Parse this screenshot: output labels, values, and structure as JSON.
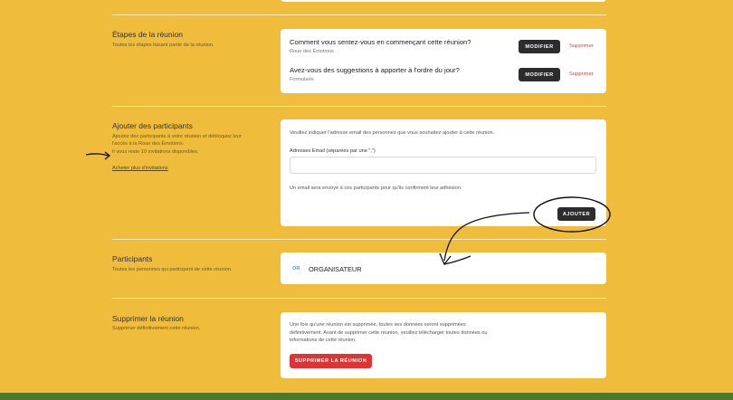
{
  "steps": {
    "title": "Étapes de la réunion",
    "description": "Toutes les étapes faisant partie de la réunion.",
    "items": [
      {
        "question": "Comment vous sentez-vous en commençant cette réunion?",
        "type": "Roue des Émotions",
        "edit_label": "MODIFIER",
        "delete_label": "Supprimer"
      },
      {
        "question": "Avez-vous des suggestions à apporter à l'ordre du jour?",
        "type": "Formulaire",
        "edit_label": "MODIFIER",
        "delete_label": "Supprimer"
      }
    ]
  },
  "add_participants": {
    "title": "Ajouter des participants",
    "description_line1": "Ajoutez des participants à votre réunion et débloquez leur",
    "description_line2": "l'accès à la Roue des Émotions.",
    "description_line3": "Il vous reste 10 invitations disponibles.",
    "buy_link": "Acheter plus d'invitations",
    "instruction": "Veuillez indiquer l'adresse email des personnes que vous souhaitez ajouter à cette réunion.",
    "email_label": "Adresses Email (séparées par une \",\")",
    "email_value": "",
    "email_placeholder": "",
    "notice": "Un email sera envoyé à ces participants pour qu'ils confirment leur adhésion.",
    "submit_label": "AJOUTER"
  },
  "participants": {
    "title": "Participants",
    "description": "Toutes les personnes qui participent de cette réunion.",
    "list": [
      {
        "initials": "OR",
        "role": "ORGANISATEUR"
      }
    ]
  },
  "delete_meeting": {
    "title": "Supprimer la réunion",
    "description": "Supprimer définitivement cette réunion.",
    "warning_line1": "Une fois qu'une réunion est supprimée, toutes ses données seront supprimées",
    "warning_line2": "définitivement. Avant de supprimer cette réunion, veuillez télécharger toutes données ou",
    "warning_line3": "informations de cette réunion.",
    "button_label": "SUPPRIMER LA RÉUNION"
  },
  "colors": {
    "background": "#f0bc3b",
    "dark_button": "#2c2c2c",
    "danger": "#e03434",
    "footer": "#4c7a2a"
  }
}
